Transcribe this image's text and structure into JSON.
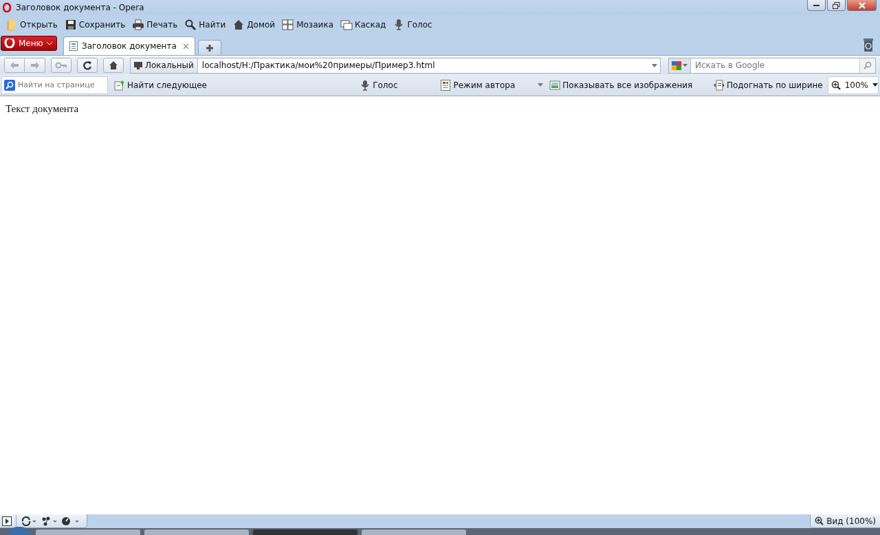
{
  "window": {
    "title": "Заголовок документа - Opera"
  },
  "toolbar": [
    {
      "kind": "folder",
      "label": "Открыть"
    },
    {
      "kind": "save",
      "label": "Сохранить"
    },
    {
      "kind": "print",
      "label": "Печать"
    },
    {
      "kind": "search",
      "label": "Найти"
    },
    {
      "kind": "home",
      "label": "Домой"
    },
    {
      "kind": "tile",
      "label": "Мозаика"
    },
    {
      "kind": "cascade",
      "label": "Каскад"
    },
    {
      "kind": "mic",
      "label": "Голос"
    }
  ],
  "menu_button": {
    "label": "Меню"
  },
  "tabs": [
    {
      "label": "Заголовок документа",
      "selected": true
    }
  ],
  "address_bar": {
    "security_label": "Локальный",
    "url": "localhost/H:/Практика/мои%20примеры/Пример3.html"
  },
  "search": {
    "placeholder": "Искать в Google"
  },
  "find_bar": {
    "placeholder": "Найти на странице",
    "items": [
      {
        "kind": "findnext",
        "label": "Найти следующее"
      },
      {
        "kind": "mic",
        "label": "Голос"
      },
      {
        "kind": "author",
        "label": "Режим автора"
      },
      {
        "kind": "image",
        "label": "Показывать все изображения"
      },
      {
        "kind": "fit",
        "label": "Подогнать по ширине"
      }
    ],
    "zoom": "100%"
  },
  "content": {
    "text": "Текст документа"
  },
  "status_bar": {
    "zoom_label": "Вид (100%)"
  }
}
